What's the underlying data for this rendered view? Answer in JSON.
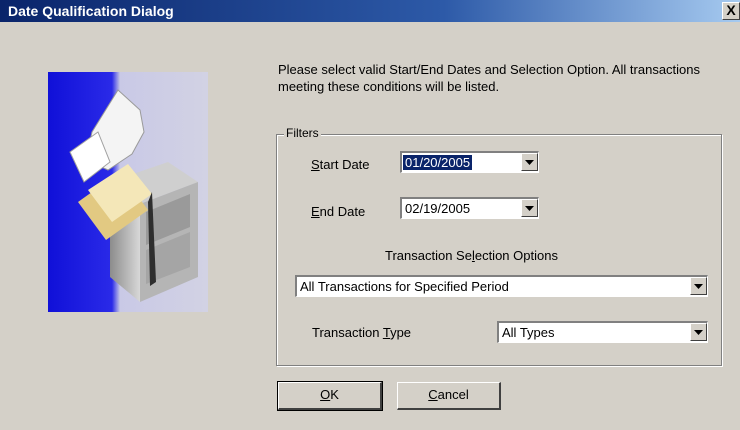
{
  "window": {
    "title": "Date Qualification Dialog",
    "close_glyph": "X"
  },
  "instruction": "Please select valid Start/End Dates and Selection Option. All transactions meeting these conditions will be listed.",
  "filters": {
    "legend": "Filters",
    "start_date": {
      "label_ul": "S",
      "label_rest": "tart Date",
      "value": "01/20/2005"
    },
    "end_date": {
      "label_ul": "E",
      "label_rest": "nd Date",
      "value": "02/19/2005"
    },
    "selection_options_label": {
      "before": "Transaction Se",
      "ul": "l",
      "after": "ection Options"
    },
    "selection_option_value": "All Transactions for Specified Period",
    "transaction_type": {
      "label_before": "Transaction ",
      "label_ul": "T",
      "label_after": "ype",
      "value": "All Types"
    }
  },
  "buttons": {
    "ok": {
      "ul": "O",
      "rest": "K"
    },
    "cancel": {
      "ul": "C",
      "rest": "ancel"
    }
  },
  "icons": [
    "close-icon",
    "dropdown-arrow-icon",
    "filing-cabinet-illustration"
  ],
  "colors": {
    "titlebar": "#0a246a",
    "face": "#d4d0c8",
    "selection": "#0a246a"
  }
}
